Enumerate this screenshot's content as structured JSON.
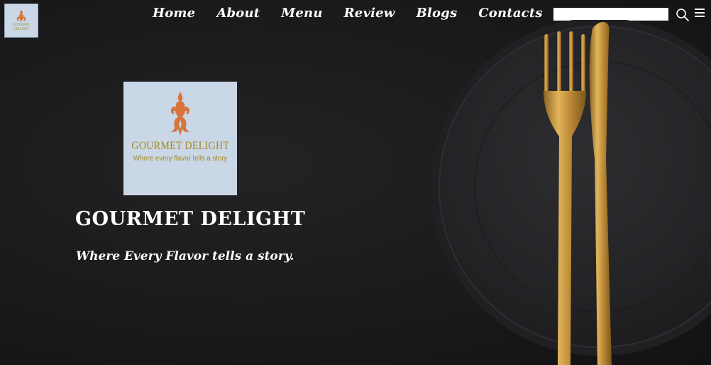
{
  "brand": {
    "name": "GOURMET DELIGHT",
    "tagline": "Where Every Flavor tells a story.",
    "logo_name": "GOURMET DELIGHT",
    "logo_tagline": "Where every flavor tells a story",
    "logo_bg": "#c9d7e6",
    "logo_text_color": "#a58a22",
    "logo_emblem_color": "#d8743a"
  },
  "nav": {
    "items": [
      {
        "label": "Home"
      },
      {
        "label": "About"
      },
      {
        "label": "Menu"
      },
      {
        "label": "Review"
      },
      {
        "label": "Blogs"
      },
      {
        "label": "Contacts"
      }
    ]
  },
  "search": {
    "value": "",
    "placeholder": ""
  },
  "icons": {
    "search": "search-icon",
    "menu": "menu-icon"
  },
  "colors": {
    "background": "#1a1a1c",
    "text": "#ffffff",
    "gold": "#c9a14a"
  }
}
